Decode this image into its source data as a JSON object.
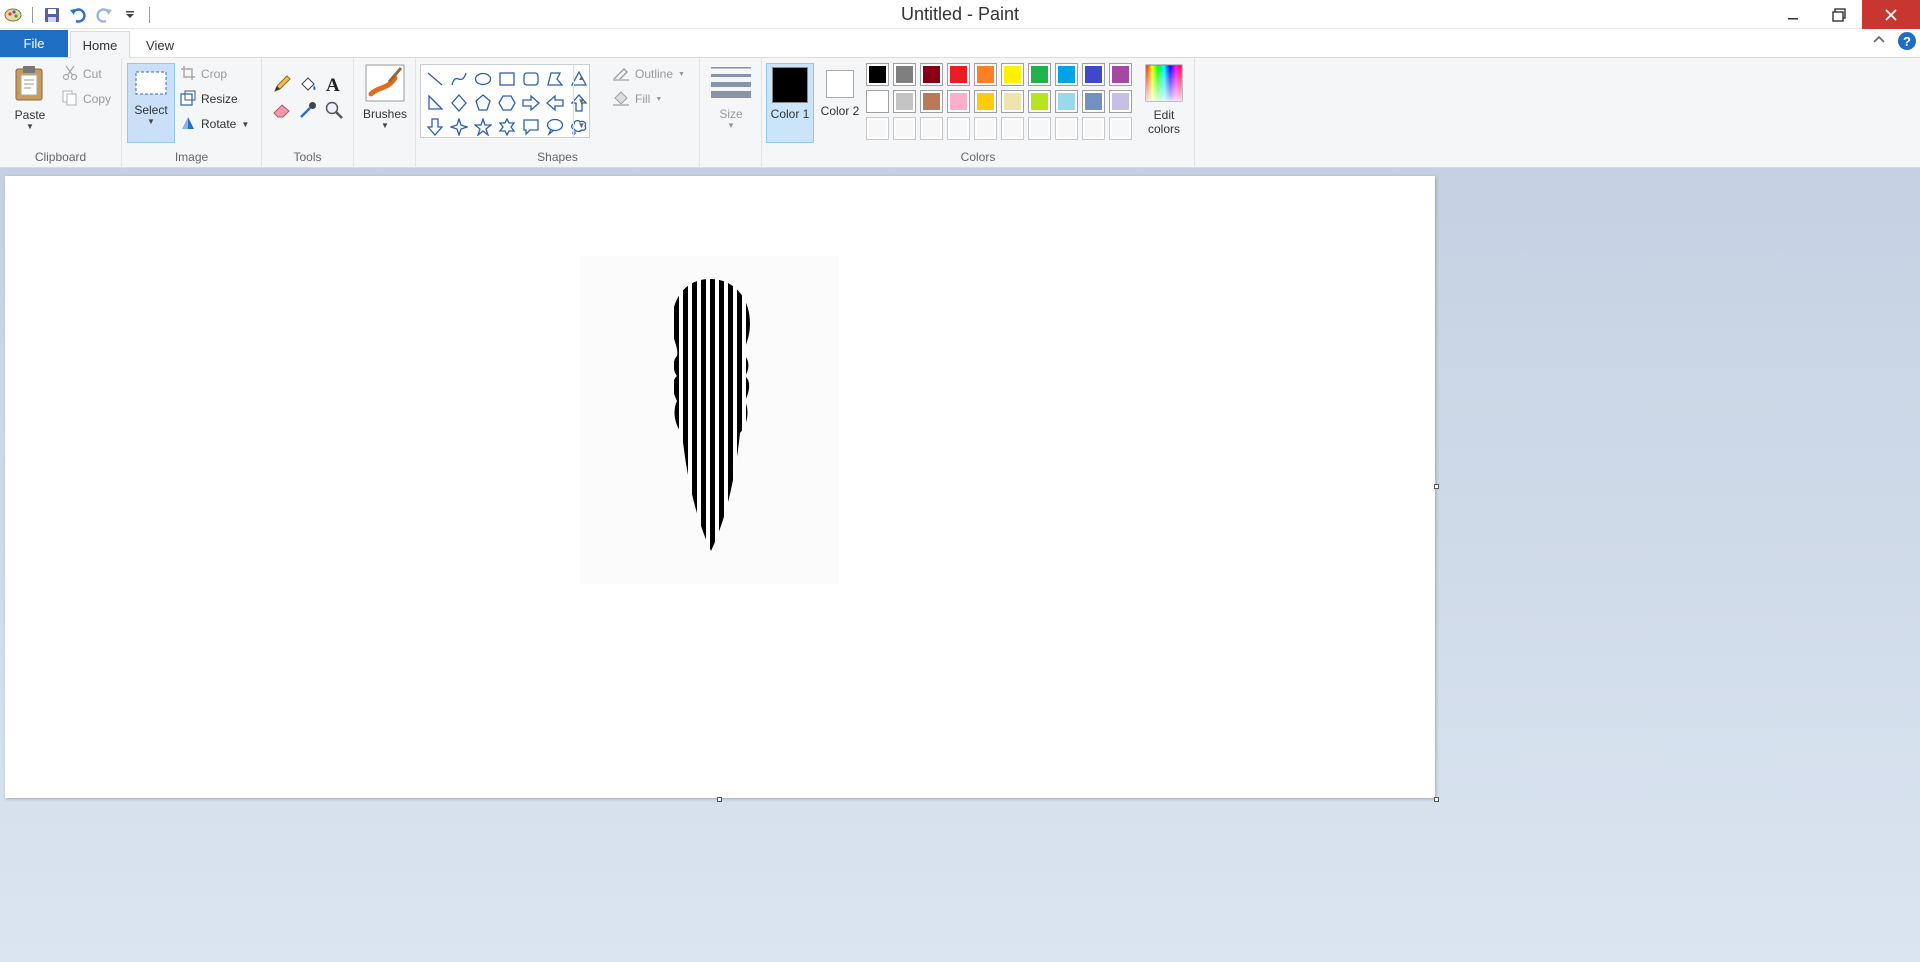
{
  "window": {
    "title": "Untitled - Paint"
  },
  "quick_access": {
    "icons": [
      "paint-app-icon",
      "save-icon",
      "undo-icon",
      "redo-icon",
      "customize-qat-icon"
    ]
  },
  "tabs": {
    "file": "File",
    "home": "Home",
    "view": "View"
  },
  "clipboard": {
    "paste": "Paste",
    "cut": "Cut",
    "copy": "Copy",
    "label": "Clipboard"
  },
  "image": {
    "select": "Select",
    "crop": "Crop",
    "resize": "Resize",
    "rotate": "Rotate",
    "label": "Image"
  },
  "tools": {
    "label": "Tools",
    "icons": [
      "pencil-icon",
      "fill-icon",
      "text-icon",
      "eraser-icon",
      "color-picker-icon",
      "magnifier-icon"
    ]
  },
  "brushes": {
    "label": "Brushes"
  },
  "shapes": {
    "label": "Shapes",
    "outline": "Outline",
    "fill": "Fill",
    "items": [
      "line",
      "curve",
      "oval",
      "rectangle",
      "rounded-rectangle",
      "polygon",
      "triangle",
      "right-triangle",
      "diamond",
      "pentagon",
      "hexagon",
      "right-arrow",
      "left-arrow",
      "up-arrow",
      "down-arrow",
      "four-point-star",
      "five-point-star",
      "six-point-star",
      "rounded-callout",
      "oval-callout",
      "cloud-callout"
    ]
  },
  "size": {
    "label": "Size"
  },
  "colors": {
    "label": "Colors",
    "color1_label": "Color 1",
    "color2_label": "Color 2",
    "edit_colors": "Edit colors",
    "color1": "#000000",
    "color2": "#ffffff",
    "palette_row1": [
      "#000000",
      "#7f7f7f",
      "#880015",
      "#ed1c24",
      "#ff7f27",
      "#fff200",
      "#22b14c",
      "#00a2e8",
      "#3f48cc",
      "#a349a4"
    ],
    "palette_row2": [
      "#ffffff",
      "#c3c3c3",
      "#b97a57",
      "#ffaec9",
      "#ffc90e",
      "#efe4b0",
      "#b5e61d",
      "#99d9ea",
      "#7092be",
      "#c8bfe7"
    ],
    "palette_row3": [
      "#ffffff",
      "#ffffff",
      "#ffffff",
      "#ffffff",
      "#ffffff",
      "#ffffff",
      "#ffffff",
      "#ffffff",
      "#ffffff",
      "#ffffff"
    ]
  }
}
